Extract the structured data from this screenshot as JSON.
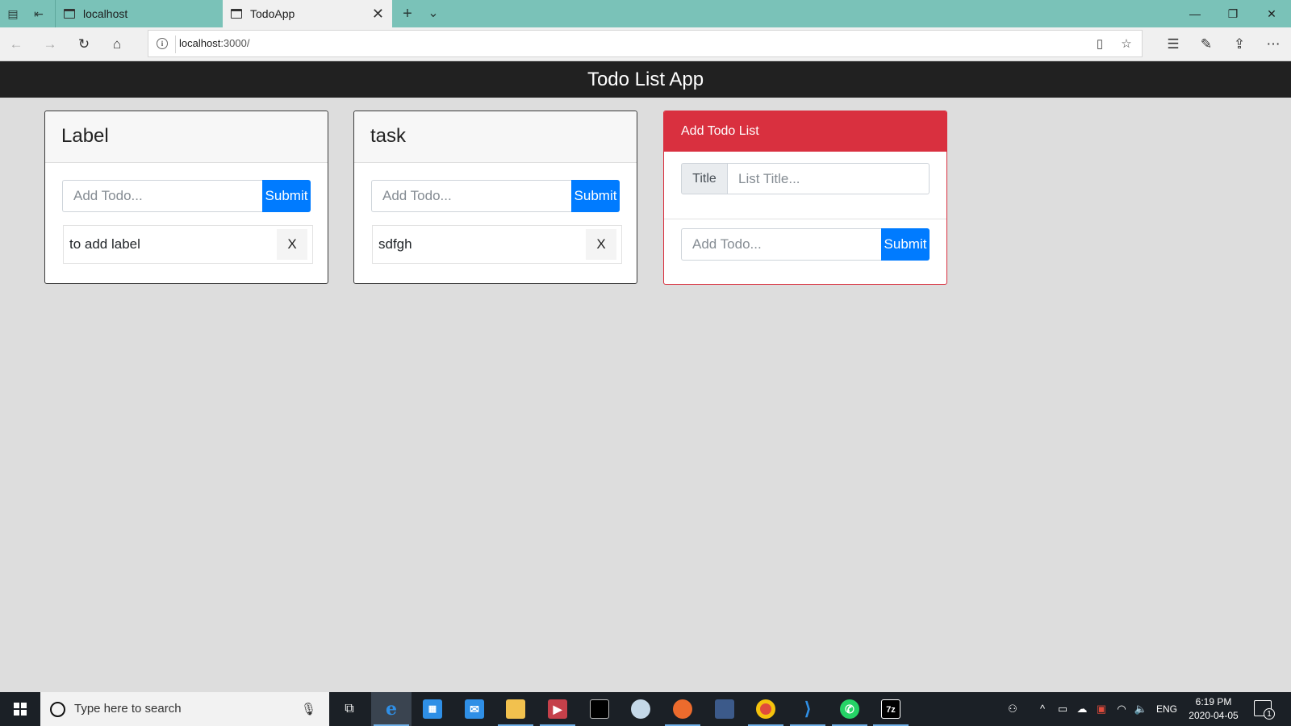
{
  "browser": {
    "tabs": [
      {
        "label": "localhost",
        "active": false
      },
      {
        "label": "TodoApp",
        "active": true
      }
    ],
    "url_host": "localhost",
    "url_path": ":3000/",
    "new_tab": "+",
    "tab_menu": "⌄"
  },
  "app": {
    "title": "Todo List App"
  },
  "lists": [
    {
      "title": "Label",
      "input_placeholder": "Add Todo...",
      "submit_label": "Submit",
      "todos": [
        {
          "text": "to add label",
          "delete_label": "X"
        }
      ]
    },
    {
      "title": "task",
      "input_placeholder": "Add Todo...",
      "submit_label": "Submit",
      "todos": [
        {
          "text": "sdfgh",
          "delete_label": "X"
        }
      ]
    }
  ],
  "add_list": {
    "header": "Add Todo List",
    "title_label": "Title",
    "title_placeholder": "List Title...",
    "todo_placeholder": "Add Todo...",
    "submit_label": "Submit"
  },
  "taskbar": {
    "search_placeholder": "Type here to search",
    "language": "ENG",
    "time": "6:19 PM",
    "date": "2020-04-05",
    "notification_count": "1",
    "pinned": [
      "edge-icon",
      "store-icon",
      "mail-icon",
      "file-explorer-icon",
      "media-player-icon",
      "terminal-icon",
      "paint-icon",
      "firefox-icon",
      "sql-server-icon",
      "chrome-icon",
      "vscode-icon",
      "whatsapp-icon",
      "7zip-icon"
    ],
    "seven_zip_label": "7z"
  },
  "colors": {
    "tab_strip": "#7ac2b8",
    "header_bg": "#212121",
    "primary": "#007bff",
    "danger": "#d9303f",
    "taskbar": "#1b2026"
  }
}
